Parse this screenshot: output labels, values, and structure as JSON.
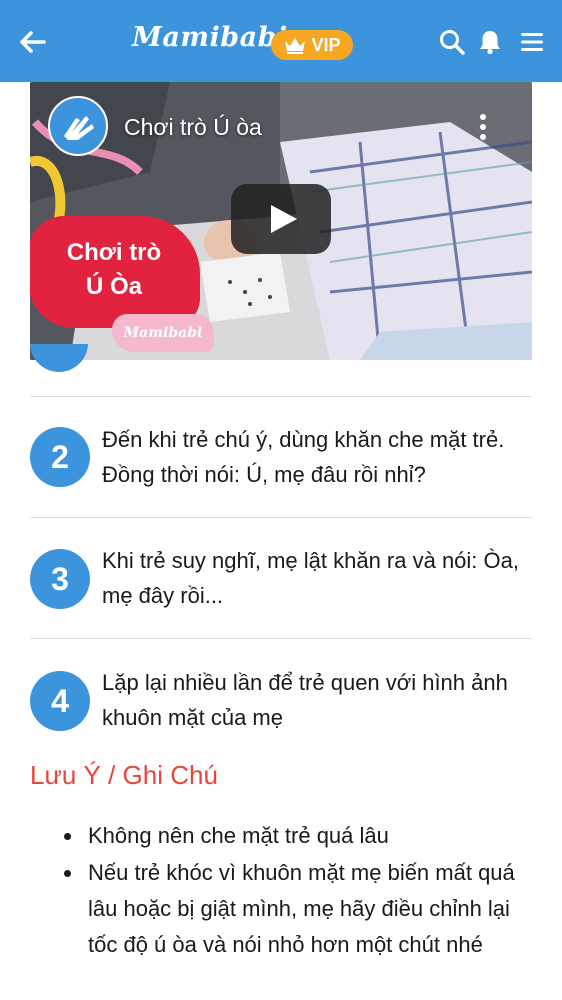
{
  "colors": {
    "header_bg": "#3c94dc",
    "vip_badge": "#f5a623",
    "step_circle": "#3c94dc",
    "notes_title": "#e8463b",
    "sticker_red": "#e1233f"
  },
  "header": {
    "back_icon": "arrow-left-icon",
    "logo_text": "Mamibabi",
    "vip_label": "VIP",
    "vip_icon": "crown-icon",
    "icons": [
      "search-icon",
      "bell-icon",
      "menu-icon"
    ]
  },
  "video": {
    "title": "Chơi trò Ú òa",
    "sticker_text_line1": "Chơi trò",
    "sticker_text_line2": "Ú Òa",
    "brand_text": "Mamibabi"
  },
  "steps": [
    {
      "number": "2",
      "text": "Đến khi trẻ chú ý, dùng khăn che mặt trẻ. Đồng thời nói: Ú, mẹ đâu rồi nhỉ?"
    },
    {
      "number": "3",
      "text": "Khi trẻ suy nghĩ, mẹ lật khăn ra và nói: Òa, mẹ đây rồi..."
    },
    {
      "number": "4",
      "text": "Lặp lại nhiều lần để trẻ quen với hình ảnh khuôn mặt của mẹ"
    }
  ],
  "notes": {
    "title": "Lưu Ý / Ghi Chú",
    "items": [
      "Không nên che mặt trẻ quá lâu",
      "Nếu trẻ khóc vì khuôn mặt mẹ biến mất quá lâu hoặc bị giật mình, mẹ hãy điều chỉnh lại tốc độ ú òa và nói nhỏ hơn một chút nhé"
    ]
  }
}
